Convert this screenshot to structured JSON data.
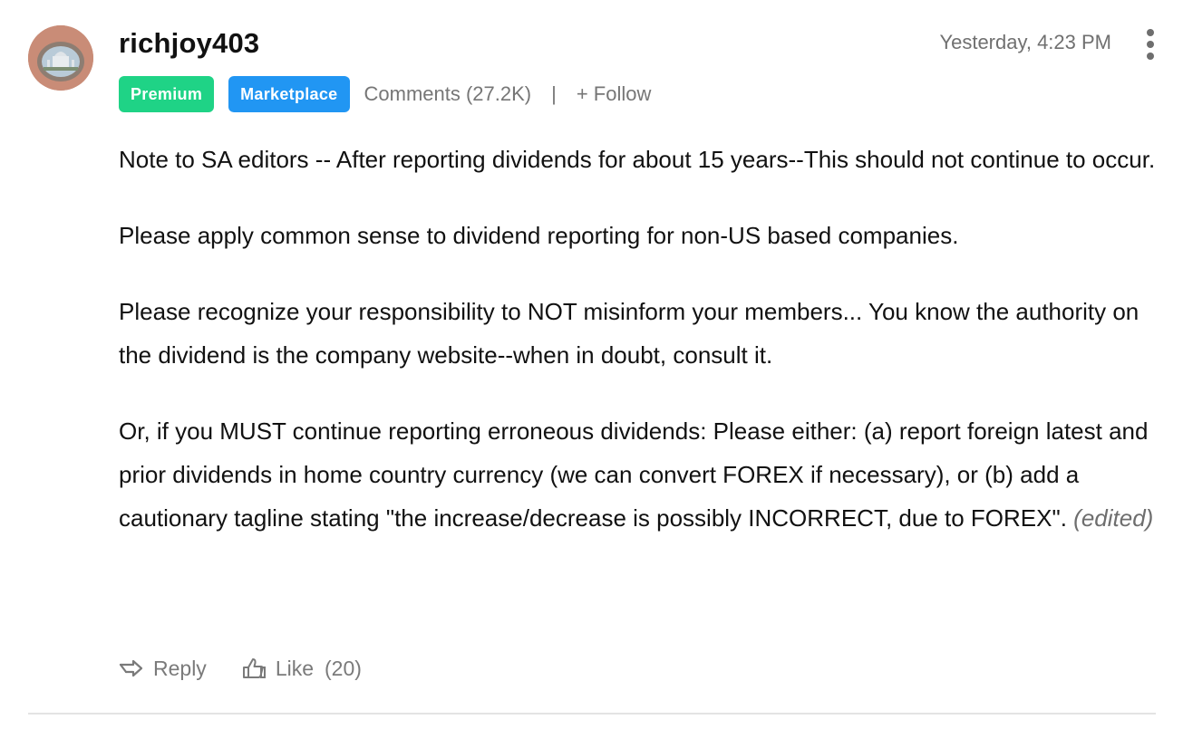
{
  "comment": {
    "author": "richjoy403",
    "timestamp": "Yesterday, 4:23 PM",
    "badges": {
      "premium": "Premium",
      "marketplace": "Marketplace"
    },
    "comments_count_label": "Comments (27.2K)",
    "separator": "|",
    "follow_label": "+ Follow",
    "paragraphs": [
      "Note to SA editors -- After reporting dividends for about 15 years--This should not continue to occur.",
      "Please apply common sense to dividend reporting for non-US based companies.",
      "Please recognize your responsibility to NOT misinform your members... You know the authority on the dividend is the company website--when in doubt, consult it.",
      "Or, if you MUST continue reporting erroneous dividends: Please either: (a) report foreign latest and prior dividends in home country currency (we can convert FOREX if necessary), or (b) add a cautionary tagline stating \"the increase/decrease is possibly INCORRECT, due to FOREX\"."
    ],
    "edited_label": "(edited)",
    "actions": {
      "reply_label": "Reply",
      "like_label": "Like",
      "like_count": "(20)"
    },
    "icons": {
      "avatar": "avatar-image",
      "more": "kebab-menu-icon",
      "reply": "reply-arrow-icon",
      "like": "thumbs-up-icon"
    },
    "colors": {
      "premium_badge": "#1fd386",
      "marketplace_badge": "#2196f3",
      "muted_text": "#767676"
    }
  }
}
